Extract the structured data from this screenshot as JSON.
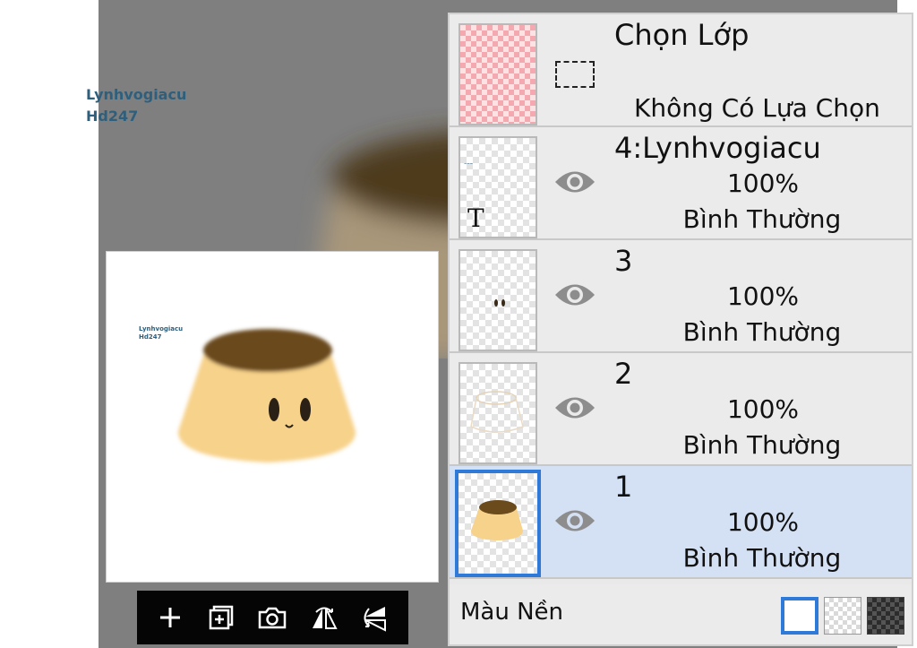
{
  "watermark": {
    "line1": "Lynhvogiacu",
    "line2": "Hd247"
  },
  "toolbar": {
    "tools": [
      "add-layer-icon",
      "duplicate-layer-icon",
      "camera-icon",
      "flip-horizontal-icon",
      "flip-vertical-icon"
    ]
  },
  "layer_panel": {
    "selection_row": {
      "title": "Chọn Lớp",
      "subtitle": "Không Có Lựa Chọn"
    },
    "layers": [
      {
        "name": "4:Lynhvogiacu",
        "opacity": "100%",
        "blend": "Bình Thường",
        "thumb_glyph": "T",
        "selected": false
      },
      {
        "name": "3",
        "opacity": "100%",
        "blend": "Bình Thường",
        "selected": false
      },
      {
        "name": "2",
        "opacity": "100%",
        "blend": "Bình Thường",
        "selected": false
      },
      {
        "name": "1",
        "opacity": "100%",
        "blend": "Bình Thường",
        "selected": true
      }
    ],
    "background": {
      "label": "Màu Nền",
      "options": [
        "white",
        "transparent",
        "dark-checker"
      ],
      "selected": "white"
    }
  },
  "colors": {
    "accent": "#2f7ad8",
    "selected_row": "#d4e1f4",
    "watermark": "#2e5f7c",
    "flan_body": "#f7d28a",
    "caramel": "#6b4a1c"
  }
}
